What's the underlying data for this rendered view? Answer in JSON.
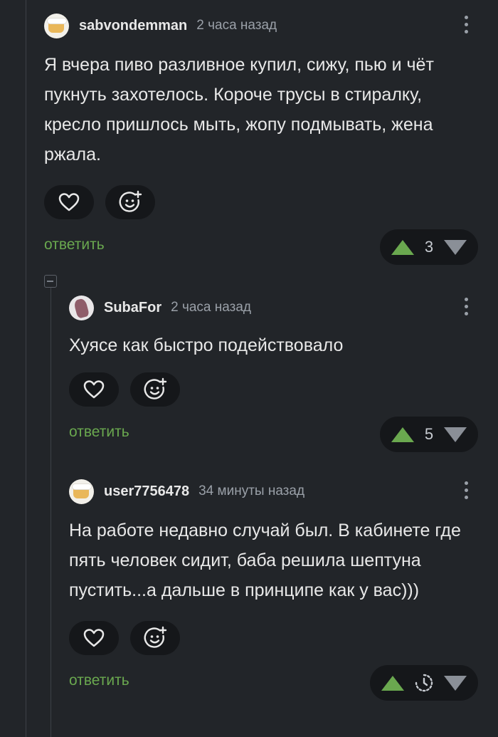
{
  "colors": {
    "background": "#222529",
    "accent_green": "#6aa84f",
    "muted": "#9aa0a8"
  },
  "comments": [
    {
      "author": "sabvondemman",
      "time": "2 часа назад",
      "avatar_icon": "beer-avatar",
      "text": "Я вчера пиво разливное купил, сижу, пью и чёт пукнуть захотелось. Короче трусы в стиралку, кресло пришлось мыть, жопу подмывать, жена ржала.",
      "reply_label": "ответить",
      "rating": "3"
    },
    {
      "author": "SubaFor",
      "time": "2 часа назад",
      "avatar_icon": "photo-avatar",
      "text": "Хуясе как быстро подействовало",
      "reply_label": "ответить",
      "rating": "5"
    },
    {
      "author": "user7756478",
      "time": "34 минуты назад",
      "avatar_icon": "beer-avatar",
      "text": "На работе недавно случай был. В кабинете где пять человек сидит, баба решила шептуна пустить...а дальше в принципе как у вас)))",
      "reply_label": "ответить",
      "rating_icon": "timer-icon"
    }
  ]
}
